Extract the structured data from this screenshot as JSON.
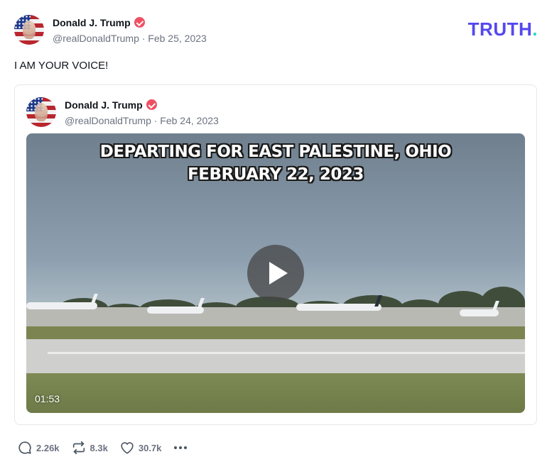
{
  "post": {
    "author_name": "Donald J. Trump",
    "author_meta": "@realDonaldTrump · Feb 25, 2023",
    "text": "I AM YOUR VOICE!"
  },
  "logo": {
    "text": "TRUTH",
    "dot": "."
  },
  "quoted": {
    "author_name": "Donald J. Trump",
    "author_meta": "@realDonaldTrump · Feb 24, 2023",
    "video": {
      "title_line1": "DEPARTING FOR EAST PALESTINE, OHIO",
      "title_line2": "FEBRUARY 22, 2023",
      "duration": "01:53"
    }
  },
  "actions": {
    "replies": "2.26k",
    "retruths": "8.3k",
    "likes": "30.7k"
  },
  "icons": [
    "verified-badge-icon",
    "comment-icon",
    "retruth-icon",
    "heart-icon",
    "more-icon",
    "play-icon"
  ],
  "colors": {
    "brand": "#5448ee",
    "brand_dot": "#2dd4bf",
    "verified": "#ef4f63",
    "muted": "#6b7280"
  }
}
